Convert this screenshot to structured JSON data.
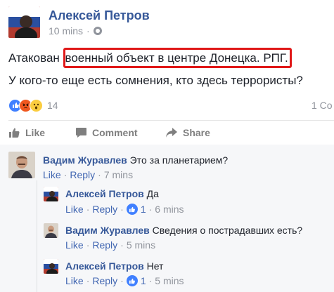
{
  "post": {
    "author": "Алексей Петров",
    "time": "10 mins",
    "text_before": "Атакован ",
    "text_highlight": "военный объект в центре Донецка. РПГ.",
    "text_line2": "У кого-то еще есть сомнения, кто здесь террористы?",
    "reaction_count": "14",
    "comment_count": "1 Co",
    "reactions": [
      "like",
      "angry",
      "wow"
    ]
  },
  "actions": {
    "like": "Like",
    "comment": "Comment",
    "share": "Share"
  },
  "comments": [
    {
      "author": "Вадим Журавлев",
      "text": "Это за планетарием?",
      "like": "Like",
      "reply": "Reply",
      "time": "7 mins"
    },
    {
      "author": "Алексей Петров",
      "text": "Да",
      "like": "Like",
      "reply": "Reply",
      "likes": "1",
      "time": "6 mins"
    },
    {
      "author": "Вадим Журавлев",
      "text": "Сведения о пострадавших есть?",
      "like": "Like",
      "reply": "Reply",
      "time": "5 mins"
    },
    {
      "author": "Алексей Петров",
      "text": "Нет",
      "like": "Like",
      "reply": "Reply",
      "likes": "1",
      "time": "5 mins"
    }
  ],
  "colors": {
    "link": "#365899",
    "meta": "#90949c",
    "highlight_border": "#e01818",
    "like_blue": "#4080ff"
  }
}
